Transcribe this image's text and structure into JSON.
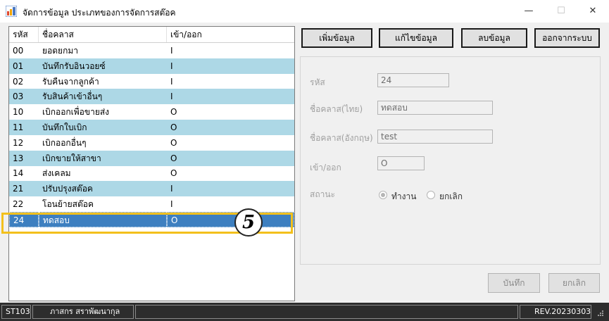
{
  "window": {
    "title": "จัดการข้อมูล ประเภทของการจัดการสต๊อค",
    "controls": {
      "minimize": "—",
      "maximize": "☐",
      "close": "✕"
    }
  },
  "grid": {
    "columns": [
      "รหัส",
      "ชื่อคลาส",
      "เข้า/ออก"
    ],
    "rows": [
      {
        "code": "00",
        "name": "ยอดยกมา",
        "io": "I"
      },
      {
        "code": "01",
        "name": "บันทึกรับอินวอยซ์",
        "io": "I"
      },
      {
        "code": "02",
        "name": "รับคืนจากลูกค้า",
        "io": "I"
      },
      {
        "code": "03",
        "name": "รับสินค้าเข้าอื่นๆ",
        "io": "I"
      },
      {
        "code": "10",
        "name": "เบิกออกเพื่อขายส่ง",
        "io": "O"
      },
      {
        "code": "11",
        "name": "บันทึกใบเบิก",
        "io": "O"
      },
      {
        "code": "12",
        "name": "เบิกออกอื่นๆ",
        "io": "O"
      },
      {
        "code": "13",
        "name": "เบิกขายให้สาขา",
        "io": "O"
      },
      {
        "code": "14",
        "name": "ส่งเคลม",
        "io": "O"
      },
      {
        "code": "21",
        "name": "ปรับปรุงสต๊อค",
        "io": "I"
      },
      {
        "code": "22",
        "name": "โอนย้ายสต๊อค",
        "io": "I"
      },
      {
        "code": "24",
        "name": "ทดสอบ",
        "io": "O"
      }
    ],
    "selected_index": 11,
    "step_marker": "5"
  },
  "toolbar": {
    "add": "เพิ่มข้อมูล",
    "edit": "แก้ไขข้อมูล",
    "delete": "ลบข้อมูล",
    "exit": "ออกจากระบบ"
  },
  "form": {
    "code_label": "รหัส",
    "code_value": "24",
    "name_th_label": "ชื่อคลาส(ไทย)",
    "name_th_value": "ทดสอบ",
    "name_en_label": "ชื่อคลาส(อังกฤษ)",
    "name_en_value": "test",
    "io_label": "เข้า/ออก",
    "io_value": "O",
    "status_label": "สถานะ",
    "status_active": "ทำงาน",
    "status_cancelled": "ยกเลิก",
    "status_selected": "active"
  },
  "actions": {
    "save": "บันทึก",
    "cancel": "ยกเลิก"
  },
  "statusbar": {
    "code": "ST103",
    "user": "ภาสกร สราพัฒนากุล",
    "middle": "",
    "revision": "REV.20230303"
  },
  "colors": {
    "row_alt": "#add8e6",
    "row_selected": "#3d7fc0",
    "highlight": "#f3c01c",
    "statusbar": "#2d2d2d"
  }
}
